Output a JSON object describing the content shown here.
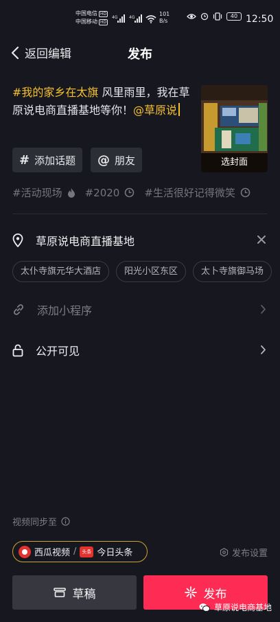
{
  "status_bar": {
    "carrier1": "中国电信",
    "carrier2": "中国移动",
    "hd": "HD",
    "signal1": "4G",
    "signal2": "4G",
    "speed_value": "101",
    "speed_unit": "B/s",
    "battery": "40",
    "time": "12:50"
  },
  "header": {
    "back_label": "返回编辑",
    "title": "发布"
  },
  "description": {
    "hashtag": "#我的家乡在太旗",
    "text": " 风里雨里，我在草原说电商直播基地等你！",
    "mention": "@草原说"
  },
  "cover": {
    "label": "选封面"
  },
  "buttons": {
    "add_topic": "添加话题",
    "friends": "朋友"
  },
  "topics": [
    "#活动现场",
    "#2020",
    "#生活很好记得微笑"
  ],
  "location": {
    "name": "草原说电商直播基地",
    "suggestions": [
      "太仆寺旗元华大酒店",
      "阳光小区东区",
      "太卜寺旗御马场"
    ]
  },
  "mini_program": {
    "label": "添加小程序"
  },
  "visibility": {
    "label": "公开可见"
  },
  "sync": {
    "label": "视频同步至",
    "xigua": "西瓜视频",
    "separator": "/",
    "toutiao_badge": "头条",
    "toutiao": "今日头条",
    "settings": "发布设置"
  },
  "actions": {
    "draft": "草稿",
    "publish": "发布"
  },
  "watermark": "草原说电商基地",
  "colors": {
    "background": "#16171f",
    "accent_yellow": "#f5c02c",
    "publish_red": "#fe2c55",
    "sync_border": "#d3a52c"
  }
}
